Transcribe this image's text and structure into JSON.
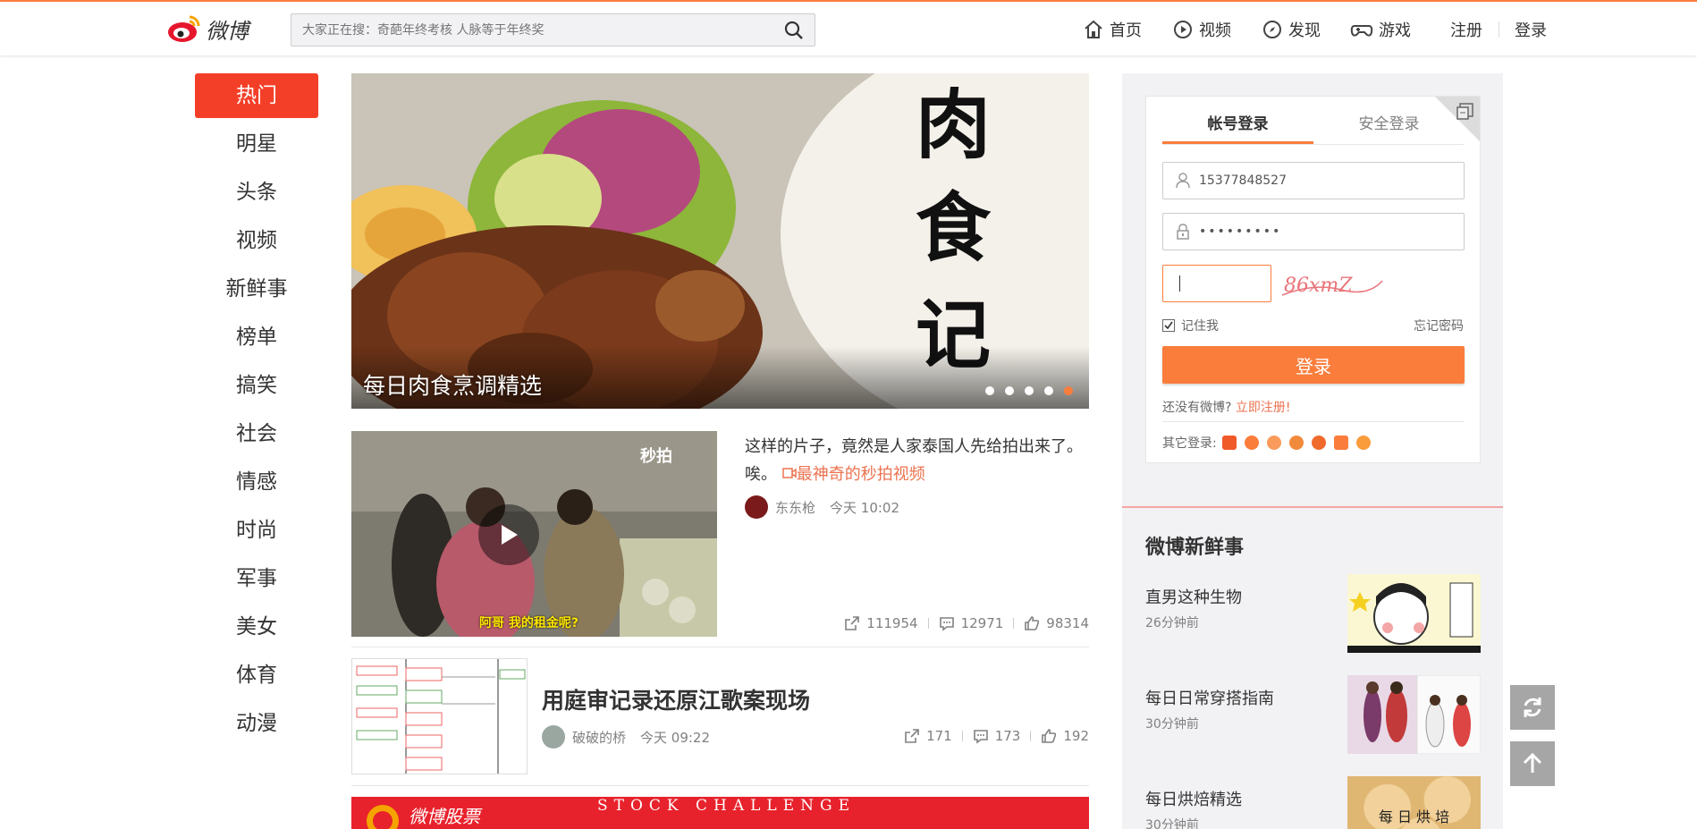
{
  "brand": {
    "logo_text": "微博",
    "accent": "#fa7d3c"
  },
  "search": {
    "placeholder": "大家正在搜：奇葩年终考核 人脉等于年终奖",
    "icon": "search-icon"
  },
  "nav": {
    "home": "首页",
    "video": "视频",
    "discover": "发现",
    "game": "游戏",
    "register": "注册",
    "login": "登录"
  },
  "sidebar": {
    "items": [
      "热门",
      "明星",
      "头条",
      "视频",
      "新鲜事",
      "榜单",
      "搞笑",
      "社会",
      "情感",
      "时尚",
      "军事",
      "美女",
      "体育",
      "动漫"
    ],
    "active_index": 0
  },
  "hero": {
    "caption": "每日肉食烹调精选",
    "poster_text": [
      "肉",
      "食",
      "记"
    ],
    "slide_count": 5,
    "active_slide": 5
  },
  "feed": [
    {
      "text": "这样的片子，竟然是人家泰国人先给拍出来了。唉。",
      "link_text": "最神奇的秒拍视频",
      "author": "东东枪",
      "time": "今天 10:02",
      "watermark": "秒拍",
      "subtitle": "阿哥 我的租金呢?",
      "shares": "111954",
      "comments": "12971",
      "likes": "98314"
    },
    {
      "title": "用庭审记录还原江歌案现场",
      "author": "破破的桥",
      "time": "今天 09:22",
      "shares": "171",
      "comments": "173",
      "likes": "192"
    }
  ],
  "banner": {
    "left_text": "微博股票",
    "right_text": "STOCK CHALLENGE"
  },
  "login": {
    "tab_account": "帐号登录",
    "tab_secure": "安全登录",
    "username": "15377848527",
    "password": "•••••••••",
    "captcha_text": "86xmZ",
    "remember": "记住我",
    "forgot": "忘记密码",
    "button": "登录",
    "no_account": "还没有微博?",
    "register_now": "立即注册!",
    "other_login": "其它登录:"
  },
  "fresh": {
    "title": "微博新鲜事",
    "items": [
      {
        "name": "直男这种生物",
        "time": "26分钟前"
      },
      {
        "name": "每日日常穿搭指南",
        "time": "30分钟前"
      },
      {
        "name": "每日烘焙精选",
        "time": "30分钟前"
      }
    ],
    "bake_thumb_text": "每 日 烘 培"
  }
}
